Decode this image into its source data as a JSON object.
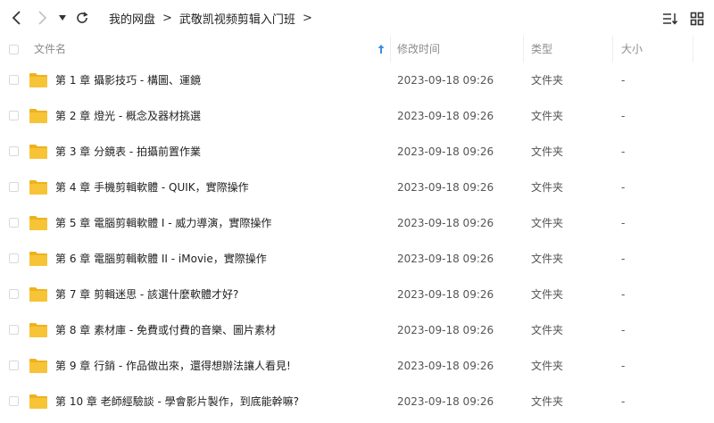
{
  "toolbar": {
    "breadcrumb": [
      "我的网盘",
      "武敬凯视频剪辑入门班"
    ],
    "breadcrumb_separator": ">",
    "icons": {
      "back": "chevron-left-icon",
      "forward": "chevron-right-icon",
      "history": "caret-down-icon",
      "refresh": "refresh-icon",
      "sort": "sort-list-icon",
      "view": "grid-view-icon"
    }
  },
  "header": {
    "name": "文件名",
    "modified": "修改时间",
    "type": "类型",
    "size": "大小",
    "sort_arrow_color": "#3a8ee6"
  },
  "rows": [
    {
      "name": "第 1 章 攝影技巧 - 構圖、運鏡",
      "modified": "2023-09-18 09:26",
      "type": "文件夹",
      "size": "-"
    },
    {
      "name": "第 2 章 燈光 - 概念及器材挑選",
      "modified": "2023-09-18 09:26",
      "type": "文件夹",
      "size": "-"
    },
    {
      "name": "第 3 章 分鏡表 - 拍攝前置作業",
      "modified": "2023-09-18 09:26",
      "type": "文件夹",
      "size": "-"
    },
    {
      "name": "第 4 章 手機剪輯軟體 - QUIK，實際操作",
      "modified": "2023-09-18 09:26",
      "type": "文件夹",
      "size": "-"
    },
    {
      "name": "第 5 章 電腦剪輯軟體 I  - 威力導演，實際操作",
      "modified": "2023-09-18 09:26",
      "type": "文件夹",
      "size": "-"
    },
    {
      "name": "第 6 章 電腦剪輯軟體 II - iMovie，實際操作",
      "modified": "2023-09-18 09:26",
      "type": "文件夹",
      "size": "-"
    },
    {
      "name": "第 7 章 剪輯迷思 - 該選什麼軟體才好?",
      "modified": "2023-09-18 09:26",
      "type": "文件夹",
      "size": "-"
    },
    {
      "name": "第 8 章 素材庫 - 免費或付費的音樂、圖片素材",
      "modified": "2023-09-18 09:26",
      "type": "文件夹",
      "size": "-"
    },
    {
      "name": "第 9 章 行銷 - 作品做出來，還得想辦法讓人看見!",
      "modified": "2023-09-18 09:26",
      "type": "文件夹",
      "size": "-"
    },
    {
      "name": "第 10 章 老師經驗談 - 學會影片製作，到底能幹嘛?",
      "modified": "2023-09-18 09:26",
      "type": "文件夹",
      "size": "-"
    }
  ],
  "colors": {
    "folder": "#f7c437",
    "folder_dark": "#eeb21f"
  }
}
